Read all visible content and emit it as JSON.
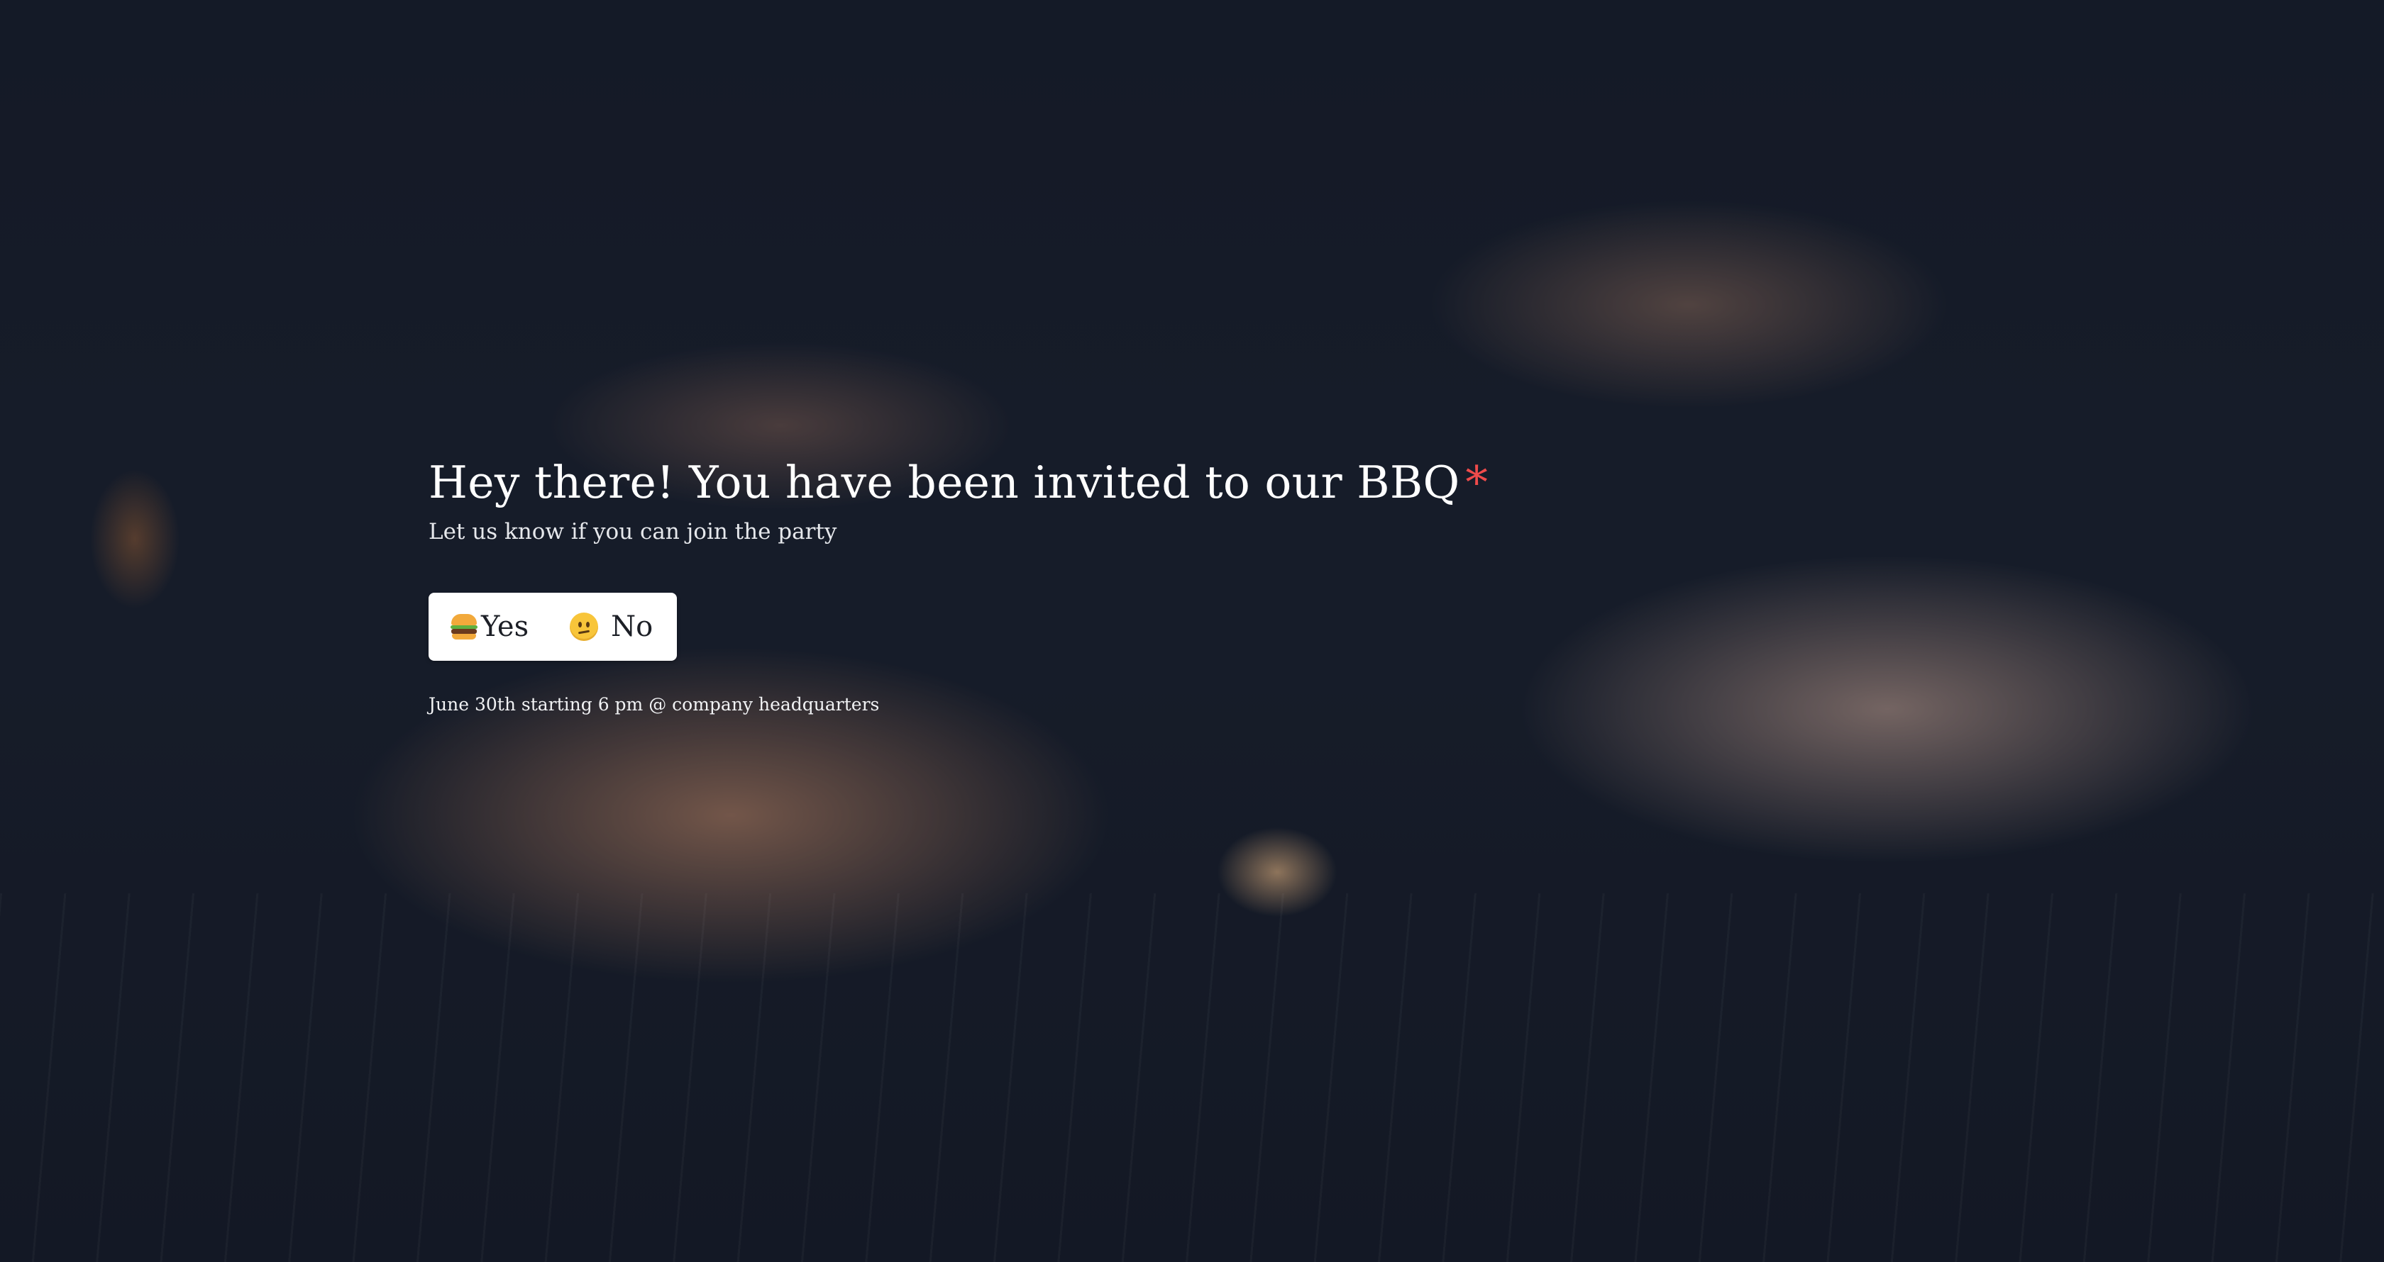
{
  "question": {
    "title": "Hey there! You have been invited to our BBQ",
    "required_marker": "*",
    "subtitle": "Let us know if you can join the party"
  },
  "choices": [
    {
      "label": "Yes",
      "icon": "burger-icon"
    },
    {
      "label": "No",
      "icon": "confused-face-icon"
    }
  ],
  "details": "June 30th starting 6 pm @ company headquarters",
  "colors": {
    "required": "#ef4b4b",
    "text": "#ffffff",
    "choice_background": "#ffffff"
  }
}
